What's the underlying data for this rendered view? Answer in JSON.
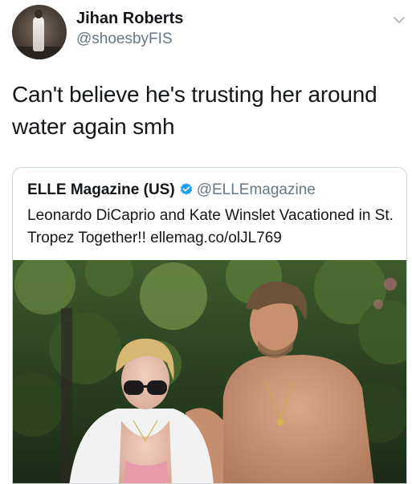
{
  "tweet": {
    "author": {
      "display_name": "Jihan Roberts",
      "handle": "@shoesbyFIS",
      "avatar_icon": "profile-photo"
    },
    "menu_icon": "chevron-down-icon",
    "text": "Can't believe he's trusting her around water again smh",
    "quoted": {
      "author_name": "ELLE Magazine (US)",
      "verified_icon": "verified-badge-icon",
      "author_handle": "@ELLEmagazine",
      "text": "Leonardo DiCaprio and Kate Winslet Vacationed in St. Tropez Together!! ellemag.co/olJL769",
      "image_icon": "photo-two-people-outdoors"
    }
  },
  "colors": {
    "text_primary": "#14171a",
    "text_secondary": "#657786",
    "verified_blue": "#1da1f2",
    "card_border": "#ccd6dd"
  }
}
